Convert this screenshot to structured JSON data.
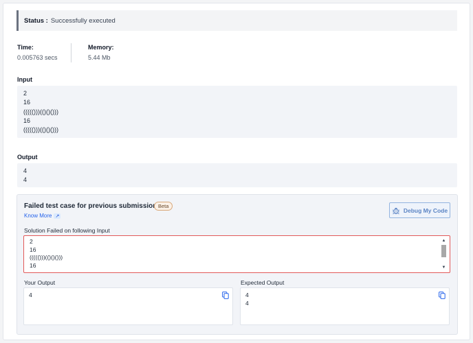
{
  "status": {
    "label": "Status :",
    "value": "Successfully executed"
  },
  "metrics": {
    "time": {
      "label": "Time:",
      "value": "0.005763 secs"
    },
    "memory": {
      "label": "Memory:",
      "value": "5.44 Mb"
    }
  },
  "input": {
    "label": "Input",
    "lines": [
      "2",
      "16",
      "((((()))(()()()))",
      "16",
      "((((()))(()()()))"
    ]
  },
  "output": {
    "label": "Output",
    "lines": [
      "4",
      "4"
    ]
  },
  "failed": {
    "title": "Failed test case for previous submission",
    "badge": "Beta",
    "know_more": "Know More",
    "debug_button": "Debug My Code",
    "input_label": "Solution Failed on following Input",
    "input_lines": [
      "2",
      "16",
      "((((()))(()()()))",
      "16"
    ],
    "your_output": {
      "label": "Your Output",
      "lines": [
        "4"
      ]
    },
    "expected_output": {
      "label": "Expected Output",
      "lines": [
        "4",
        "4"
      ]
    }
  },
  "colors": {
    "accent": "#2563eb",
    "error_border": "#e25858",
    "debug_button": "#5b84c4"
  }
}
